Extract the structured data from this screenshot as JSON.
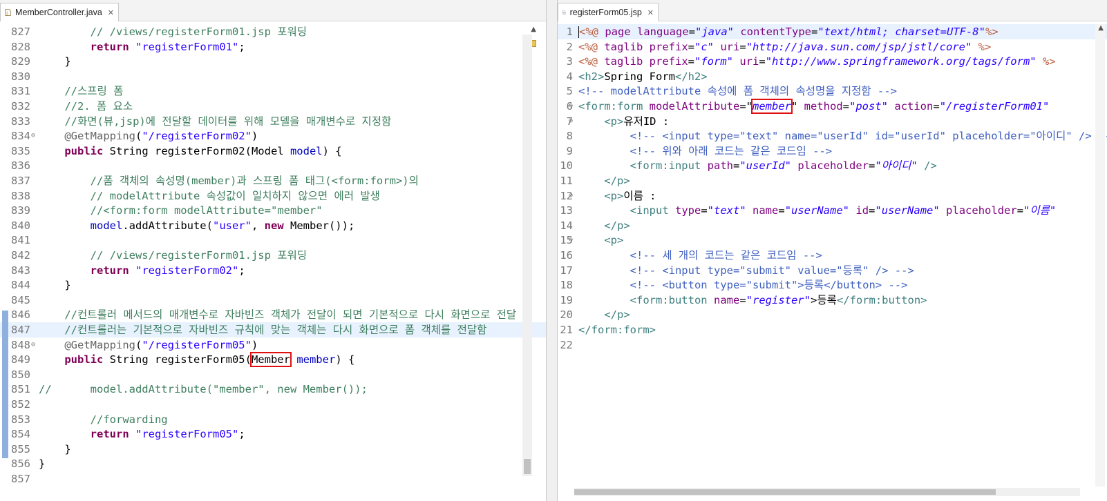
{
  "left_editor": {
    "tab_label": "MemberController.java",
    "lines": [
      {
        "n": "827",
        "segs": [
          {
            "t": "        "
          },
          {
            "t": "// /views/registerForm01.jsp 포워딩",
            "c": "cm"
          }
        ]
      },
      {
        "n": "828",
        "segs": [
          {
            "t": "        "
          },
          {
            "t": "return",
            "c": "kw"
          },
          {
            "t": " "
          },
          {
            "t": "\"registerForm01\"",
            "c": "st"
          },
          {
            "t": ";"
          }
        ]
      },
      {
        "n": "829",
        "segs": [
          {
            "t": "    }"
          }
        ]
      },
      {
        "n": "830",
        "segs": []
      },
      {
        "n": "831",
        "segs": [
          {
            "t": "    "
          },
          {
            "t": "//스프링 폼",
            "c": "cm"
          }
        ]
      },
      {
        "n": "832",
        "segs": [
          {
            "t": "    "
          },
          {
            "t": "//2. 폼 요소",
            "c": "cm"
          }
        ]
      },
      {
        "n": "833",
        "segs": [
          {
            "t": "    "
          },
          {
            "t": "//화면(뷰,jsp)에 전달할 데이터를 위해 모델을 매개변수로 지정함",
            "c": "cm"
          }
        ]
      },
      {
        "n": "834",
        "fold": true,
        "segs": [
          {
            "t": "    "
          },
          {
            "t": "@GetMapping",
            "c": "an"
          },
          {
            "t": "("
          },
          {
            "t": "\"/registerForm02\"",
            "c": "st"
          },
          {
            "t": ")"
          }
        ]
      },
      {
        "n": "835",
        "segs": [
          {
            "t": "    "
          },
          {
            "t": "public",
            "c": "kw"
          },
          {
            "t": " String registerForm02(Model "
          },
          {
            "t": "model",
            "c": "fld"
          },
          {
            "t": ") {"
          }
        ]
      },
      {
        "n": "836",
        "segs": []
      },
      {
        "n": "837",
        "segs": [
          {
            "t": "        "
          },
          {
            "t": "//폼 객체의 속성명(member)과 스프링 폼 태그(<form:form>)의",
            "c": "cm"
          }
        ]
      },
      {
        "n": "838",
        "segs": [
          {
            "t": "        "
          },
          {
            "t": "// modelAttribute 속성값이 일치하지 않으면 에러 발생",
            "c": "cm"
          }
        ]
      },
      {
        "n": "839",
        "segs": [
          {
            "t": "        "
          },
          {
            "t": "//<form:form modelAttribute=\"member\"",
            "c": "cm"
          }
        ]
      },
      {
        "n": "840",
        "segs": [
          {
            "t": "        "
          },
          {
            "t": "model",
            "c": "fld"
          },
          {
            "t": ".addAttribute("
          },
          {
            "t": "\"user\"",
            "c": "st"
          },
          {
            "t": ", "
          },
          {
            "t": "new",
            "c": "kw"
          },
          {
            "t": " Member());"
          }
        ]
      },
      {
        "n": "841",
        "segs": []
      },
      {
        "n": "842",
        "segs": [
          {
            "t": "        "
          },
          {
            "t": "// /views/registerForm01.jsp 포워딩",
            "c": "cm"
          }
        ]
      },
      {
        "n": "843",
        "segs": [
          {
            "t": "        "
          },
          {
            "t": "return",
            "c": "kw"
          },
          {
            "t": " "
          },
          {
            "t": "\"registerForm02\"",
            "c": "st"
          },
          {
            "t": ";"
          }
        ]
      },
      {
        "n": "844",
        "segs": [
          {
            "t": "    }"
          }
        ]
      },
      {
        "n": "845",
        "segs": []
      },
      {
        "n": "846",
        "segs": [
          {
            "t": "    "
          },
          {
            "t": "//컨트롤러 메서드의 매개변수로 자바빈즈 객체가 전달이 되면 기본적으로 다시 화면으로 전달",
            "c": "cm"
          }
        ]
      },
      {
        "n": "847",
        "hl": true,
        "segs": [
          {
            "t": "    "
          },
          {
            "t": "//컨트롤러는 기본적으로 자바빈즈 규칙에 맞는 객체는 다시 화면으로 폼 객체를 전달함",
            "c": "cm"
          }
        ]
      },
      {
        "n": "848",
        "fold": true,
        "segs": [
          {
            "t": "    "
          },
          {
            "t": "@GetMapping",
            "c": "an"
          },
          {
            "t": "("
          },
          {
            "t": "\"/registerForm05\"",
            "c": "st"
          },
          {
            "t": ")"
          }
        ]
      },
      {
        "n": "849",
        "segs": [
          {
            "t": "    "
          },
          {
            "t": "public",
            "c": "kw"
          },
          {
            "t": " String registerForm05("
          },
          {
            "t": "Member",
            "box": true
          },
          {
            "t": " "
          },
          {
            "t": "member",
            "c": "fld"
          },
          {
            "t": ") {"
          }
        ]
      },
      {
        "n": "850",
        "segs": []
      },
      {
        "n": "851",
        "segs": [
          {
            "t": "//      model.addAttribute(\"member\", new Member());",
            "c": "cm"
          }
        ]
      },
      {
        "n": "852",
        "segs": []
      },
      {
        "n": "853",
        "segs": [
          {
            "t": "        "
          },
          {
            "t": "//forwarding",
            "c": "cm"
          }
        ]
      },
      {
        "n": "854",
        "segs": [
          {
            "t": "        "
          },
          {
            "t": "return",
            "c": "kw"
          },
          {
            "t": " "
          },
          {
            "t": "\"registerForm05\"",
            "c": "st"
          },
          {
            "t": ";"
          }
        ]
      },
      {
        "n": "855",
        "segs": [
          {
            "t": "    }"
          }
        ]
      },
      {
        "n": "856",
        "segs": [
          {
            "t": "}"
          }
        ]
      },
      {
        "n": "857",
        "segs": []
      }
    ]
  },
  "right_editor": {
    "tab_label": "registerForm05.jsp",
    "lines": [
      {
        "n": "1",
        "hl": true,
        "caret": true,
        "segs": [
          {
            "t": "<%@",
            "c": "jsp"
          },
          {
            "t": " page ",
            "c": "at"
          },
          {
            "t": "language",
            "c": "at"
          },
          {
            "t": "="
          },
          {
            "t": "\"java\"",
            "c": "av"
          },
          {
            "t": " "
          },
          {
            "t": "contentType",
            "c": "at"
          },
          {
            "t": "="
          },
          {
            "t": "\"text/html; charset=UTF-8\"",
            "c": "av"
          },
          {
            "t": "%>",
            "c": "jsp"
          }
        ]
      },
      {
        "n": "2",
        "segs": [
          {
            "t": "<%@",
            "c": "jsp"
          },
          {
            "t": " taglib ",
            "c": "at"
          },
          {
            "t": "prefix",
            "c": "at"
          },
          {
            "t": "="
          },
          {
            "t": "\"c\"",
            "c": "av"
          },
          {
            "t": " "
          },
          {
            "t": "uri",
            "c": "at"
          },
          {
            "t": "="
          },
          {
            "t": "\"http://java.sun.com/jsp/jstl/core\"",
            "c": "av"
          },
          {
            "t": " "
          },
          {
            "t": "%>",
            "c": "jsp"
          }
        ]
      },
      {
        "n": "3",
        "segs": [
          {
            "t": "<%@",
            "c": "jsp"
          },
          {
            "t": " taglib ",
            "c": "at"
          },
          {
            "t": "prefix",
            "c": "at"
          },
          {
            "t": "="
          },
          {
            "t": "\"form\"",
            "c": "av"
          },
          {
            "t": " "
          },
          {
            "t": "uri",
            "c": "at"
          },
          {
            "t": "="
          },
          {
            "t": "\"http://www.springframework.org/tags/form\"",
            "c": "av"
          },
          {
            "t": " %>",
            "c": "jsp"
          }
        ]
      },
      {
        "n": "4",
        "segs": [
          {
            "t": "<h2>",
            "c": "tag"
          },
          {
            "t": "Spring Form"
          },
          {
            "t": "</h2>",
            "c": "tag"
          }
        ]
      },
      {
        "n": "5",
        "segs": [
          {
            "t": "<!-- modelAttribute 속성에 폼 객체의 속성명을 지정함 -->",
            "c": "cmk"
          }
        ]
      },
      {
        "n": "6",
        "fold": true,
        "segs": [
          {
            "t": "<form:form",
            "c": "tag"
          },
          {
            "t": " "
          },
          {
            "t": "modelAttribute",
            "c": "at"
          },
          {
            "t": "=\""
          },
          {
            "t": "member",
            "c": "av",
            "box": true
          },
          {
            "t": "\" "
          },
          {
            "t": "method",
            "c": "at"
          },
          {
            "t": "="
          },
          {
            "t": "\"post\"",
            "c": "av"
          },
          {
            "t": " "
          },
          {
            "t": "action",
            "c": "at"
          },
          {
            "t": "="
          },
          {
            "t": "\"/registerForm01\"",
            "c": "av"
          }
        ]
      },
      {
        "n": "7",
        "fold": true,
        "segs": [
          {
            "t": "    "
          },
          {
            "t": "<p>",
            "c": "tag"
          },
          {
            "t": "유저ID :"
          }
        ]
      },
      {
        "n": "8",
        "segs": [
          {
            "t": "        "
          },
          {
            "t": "<!-- <input type=\"text\" name=\"userId\" id=\"userId\" placeholder=\"아이디\" /> -->",
            "c": "cmk"
          }
        ]
      },
      {
        "n": "9",
        "segs": [
          {
            "t": "        "
          },
          {
            "t": "<!-- 위와 아래 코드는 같은 코드임 -->",
            "c": "cmk"
          }
        ]
      },
      {
        "n": "10",
        "segs": [
          {
            "t": "        "
          },
          {
            "t": "<form:input",
            "c": "tag"
          },
          {
            "t": " "
          },
          {
            "t": "path",
            "c": "at"
          },
          {
            "t": "="
          },
          {
            "t": "\"userId\"",
            "c": "av"
          },
          {
            "t": " "
          },
          {
            "t": "placeholder",
            "c": "at"
          },
          {
            "t": "="
          },
          {
            "t": "\"아이디\"",
            "c": "av"
          },
          {
            "t": " "
          },
          {
            "t": "/>",
            "c": "tag"
          }
        ]
      },
      {
        "n": "11",
        "segs": [
          {
            "t": "    "
          },
          {
            "t": "</p>",
            "c": "tag"
          }
        ]
      },
      {
        "n": "12",
        "fold": true,
        "segs": [
          {
            "t": "    "
          },
          {
            "t": "<p>",
            "c": "tag"
          },
          {
            "t": "이름 :"
          }
        ]
      },
      {
        "n": "13",
        "segs": [
          {
            "t": "        "
          },
          {
            "t": "<input",
            "c": "tag"
          },
          {
            "t": " "
          },
          {
            "t": "type",
            "c": "at"
          },
          {
            "t": "="
          },
          {
            "t": "\"text\"",
            "c": "av"
          },
          {
            "t": " "
          },
          {
            "t": "name",
            "c": "at"
          },
          {
            "t": "="
          },
          {
            "t": "\"userName\"",
            "c": "av"
          },
          {
            "t": " "
          },
          {
            "t": "id",
            "c": "at"
          },
          {
            "t": "="
          },
          {
            "t": "\"userName\"",
            "c": "av"
          },
          {
            "t": " "
          },
          {
            "t": "placeholder",
            "c": "at"
          },
          {
            "t": "="
          },
          {
            "t": "\"이름\"",
            "c": "av"
          }
        ]
      },
      {
        "n": "14",
        "segs": [
          {
            "t": "    "
          },
          {
            "t": "</p>",
            "c": "tag"
          }
        ]
      },
      {
        "n": "15",
        "fold": true,
        "segs": [
          {
            "t": "    "
          },
          {
            "t": "<p>",
            "c": "tag"
          }
        ]
      },
      {
        "n": "16",
        "segs": [
          {
            "t": "        "
          },
          {
            "t": "<!-- 세 개의 코드는 같은 코드임 -->",
            "c": "cmk"
          }
        ]
      },
      {
        "n": "17",
        "segs": [
          {
            "t": "        "
          },
          {
            "t": "<!-- <input type=\"submit\" value=\"등록\" /> -->",
            "c": "cmk"
          }
        ]
      },
      {
        "n": "18",
        "segs": [
          {
            "t": "        "
          },
          {
            "t": "<!-- <button type=\"submit\">등록</button> -->",
            "c": "cmk"
          }
        ]
      },
      {
        "n": "19",
        "segs": [
          {
            "t": "        "
          },
          {
            "t": "<form:button",
            "c": "tag"
          },
          {
            "t": " "
          },
          {
            "t": "name",
            "c": "at"
          },
          {
            "t": "="
          },
          {
            "t": "\"register\"",
            "c": "av"
          },
          {
            "t": ">"
          },
          {
            "t": "등록"
          },
          {
            "t": "</form:button>",
            "c": "tag"
          }
        ]
      },
      {
        "n": "20",
        "segs": [
          {
            "t": "    "
          },
          {
            "t": "</p>",
            "c": "tag"
          }
        ]
      },
      {
        "n": "21",
        "segs": [
          {
            "t": "</form:form>",
            "c": "tag"
          }
        ]
      },
      {
        "n": "22",
        "segs": []
      }
    ]
  }
}
